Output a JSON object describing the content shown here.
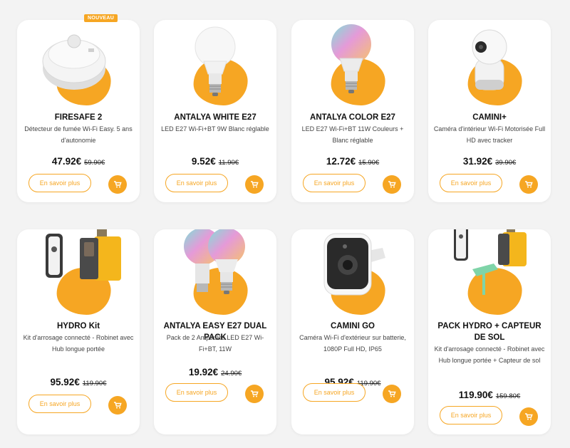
{
  "colors": {
    "accent": "#f6a623",
    "background": "#f3f3f3",
    "card": "#ffffff"
  },
  "badge": "NOUVEAU",
  "more_label": "En savoir plus",
  "products": [
    {
      "title": "FIRESAFE 2",
      "desc": "Détecteur de fumée Wi-Fi Easy.  5 ans d'autonomie",
      "price": "47.92€",
      "old_price": "59.90€",
      "image": "smoke-detector"
    },
    {
      "title": "ANTALYA WHITE E27",
      "desc": "LED E27 Wi-Fi+BT 9W Blanc réglable",
      "price": "9.52€",
      "old_price": "11.90€",
      "image": "white-bulb"
    },
    {
      "title": "ANTALYA COLOR E27",
      "desc": "LED E27 Wi-Fi+BT 11W Couleurs + Blanc réglable",
      "price": "12.72€",
      "old_price": "15.90€",
      "image": "color-bulb"
    },
    {
      "title": "CAMINI+",
      "desc": "Caméra d'intérieur Wi-Fi Motorisée Full HD avec tracker",
      "price": "31.92€",
      "old_price": "39.90€",
      "image": "indoor-camera"
    },
    {
      "title": "HYDRO Kit",
      "desc": "Kit d'arrosage connecté  - Robinet avec Hub longue portée",
      "price": "95.92€",
      "old_price": "119.90€",
      "image": "water-valve-hub"
    },
    {
      "title": "ANTALYA EASY E27 DUAL PACK",
      "desc": "Pack de 2 Ampoules LED E27 Wi-Fi+BT, 11W",
      "price": "19.92€",
      "old_price": "24.90€",
      "image": "dual-color-bulbs"
    },
    {
      "title": "CAMINI GO",
      "desc": "Caméra Wi-Fi d'extérieur sur batterie, 1080P Full HD, IP65",
      "price": "95.92€",
      "old_price": "119.90€",
      "image": "outdoor-camera"
    },
    {
      "title": "PACK HYDRO + CAPTEUR DE SOL",
      "desc": "Kit d'arrosage connecté - Robinet avec Hub longue portée + Capteur de sol",
      "price": "119.90€",
      "old_price": "159.80€",
      "image": "water-valve-soil-sensor"
    }
  ]
}
